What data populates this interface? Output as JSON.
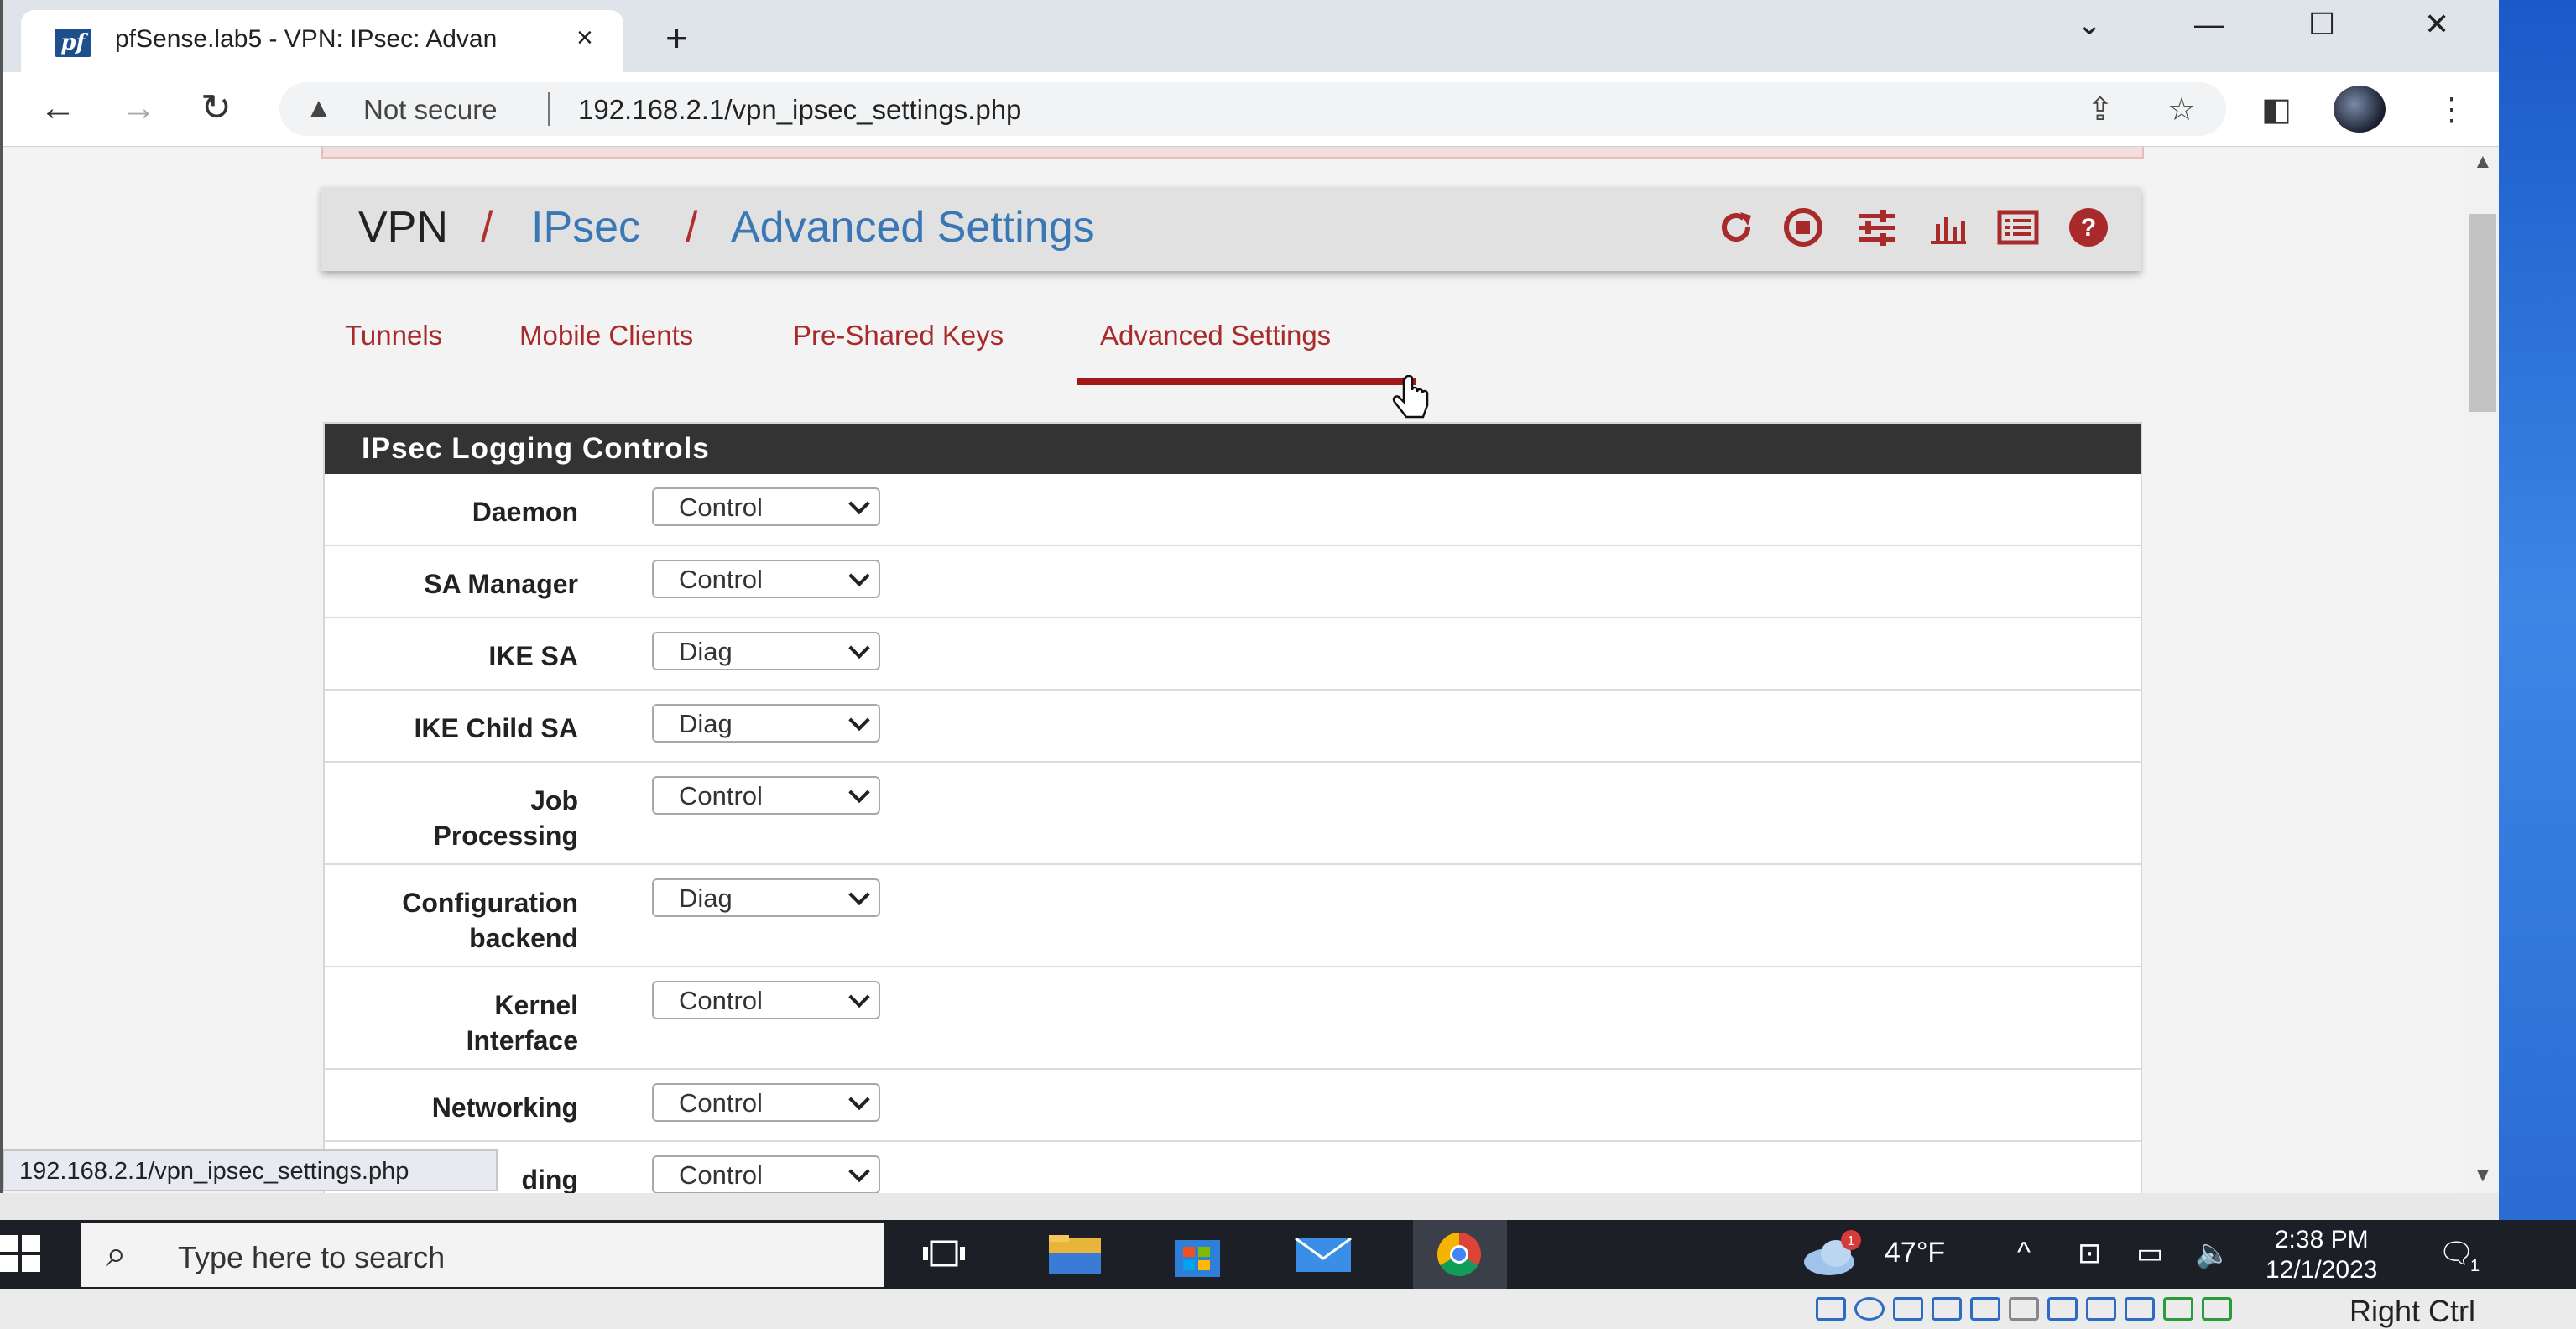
{
  "browser": {
    "tab_title": "pfSense.lab5 - VPN: IPsec: Advan",
    "new_tab": "+",
    "close_tab": "×",
    "not_secure": "Not secure",
    "url": "192.168.2.1/vpn_ipsec_settings.php"
  },
  "breadcrumb": {
    "vpn": "VPN",
    "ipsec": "IPsec",
    "advanced": "Advanced Settings",
    "sep": "/"
  },
  "tabs": {
    "tunnels": "Tunnels",
    "mobile": "Mobile Clients",
    "psk": "Pre-Shared Keys",
    "advanced": "Advanced Settings"
  },
  "panel": {
    "heading": "IPsec Logging Controls",
    "rows": [
      {
        "label": "Daemon",
        "value": "Control"
      },
      {
        "label": "SA Manager",
        "value": "Control"
      },
      {
        "label": "IKE SA",
        "value": "Diag"
      },
      {
        "label": "IKE Child SA",
        "value": "Diag"
      },
      {
        "label": "Job\nProcessing",
        "value": "Control"
      },
      {
        "label": "Configuration\nbackend",
        "value": "Diag"
      },
      {
        "label": "Kernel\nInterface",
        "value": "Control"
      },
      {
        "label": "Networking",
        "value": "Control"
      },
      {
        "label": "ding",
        "value": "Control"
      }
    ]
  },
  "status_url": "192.168.2.1/vpn_ipsec_settings.php",
  "taskbar": {
    "search_placeholder": "Type here to search",
    "weather": "47°F",
    "weather_badge": "1",
    "time": "2:38 PM",
    "date": "12/1/2023",
    "notif_count": "1"
  },
  "vbox": {
    "host_key": "Right Ctrl"
  },
  "colors": {
    "accent": "#a82a2a",
    "link": "#3a77b5",
    "panel_head": "#333333"
  }
}
